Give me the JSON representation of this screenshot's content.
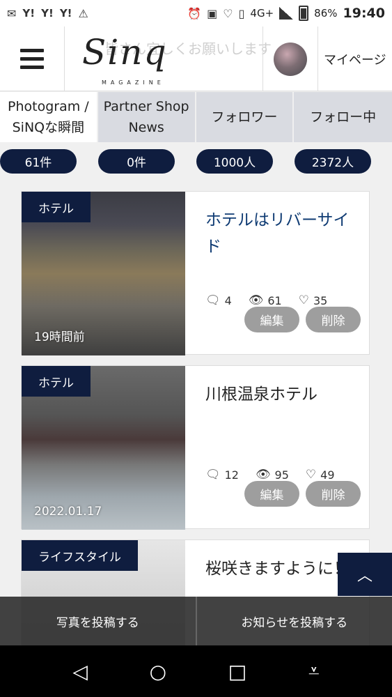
{
  "status_bar": {
    "left_icons": [
      "mail-icon",
      "yahoo-icon",
      "yahoo-icon",
      "yahoo-icon",
      "warning-icon"
    ],
    "yahoo_label": "Y!",
    "network": "4G+",
    "battery": "86%",
    "time": "19:40"
  },
  "header": {
    "logo_text": "Sinq",
    "logo_sub": "MAGAZINE",
    "marquee": "皆さん宜しくお願いします",
    "mypage_label": "マイページ"
  },
  "tabs": [
    {
      "label": "Photogram / SiNQな瞬間",
      "active": true
    },
    {
      "label": "Partner Shop News"
    },
    {
      "label": "フォロワー"
    },
    {
      "label": "フォロー中"
    }
  ],
  "counts": [
    "61件",
    "0件",
    "1000人",
    "2372人"
  ],
  "posts": [
    {
      "category": "ホテル",
      "date": "19時間前",
      "title": "ホテルはリバーサイド",
      "comments": "4",
      "views": "61",
      "likes": "35",
      "edit_label": "編集",
      "delete_label": "削除"
    },
    {
      "category": "ホテル",
      "date": "2022.01.17",
      "title": "川根温泉ホテル",
      "comments": "12",
      "views": "95",
      "likes": "49",
      "edit_label": "編集",
      "delete_label": "削除"
    },
    {
      "category": "ライフスタイル",
      "title": "桜咲きますように！"
    }
  ],
  "bottom_actions": {
    "post_photo": "写真を投稿する",
    "post_news": "お知らせを投稿する"
  },
  "colors": {
    "navy": "#0f1d3f",
    "title_blue": "#0f3b73",
    "button_gray": "#9e9e9e",
    "tab_inactive": "#d9dbe1"
  }
}
